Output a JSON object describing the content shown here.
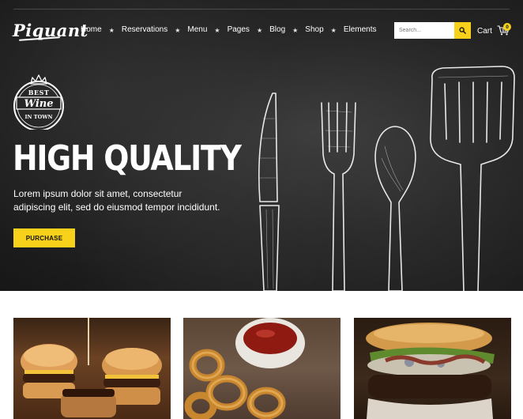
{
  "brand": {
    "name": "Piquant"
  },
  "nav": {
    "items": [
      {
        "label": "Home"
      },
      {
        "label": "Reservations"
      },
      {
        "label": "Menu"
      },
      {
        "label": "Pages"
      },
      {
        "label": "Blog"
      },
      {
        "label": "Shop"
      },
      {
        "label": "Elements"
      }
    ]
  },
  "search": {
    "placeholder": "Search..."
  },
  "cart": {
    "label": "Cart",
    "count": "0"
  },
  "hero": {
    "badge": {
      "top": "BEST",
      "middle": "Wine",
      "bottom": "IN TOWN"
    },
    "headline": "HIGH QUALITY",
    "subtext": "Lorem ipsum dolor sit amet, consectetur adipiscing elit, sed do eiusmod tempor incididunt.",
    "button_label": "PURCHASE"
  },
  "cards": [
    {
      "image": "sliders-burgers-photo"
    },
    {
      "image": "onion-rings-ketchup-photo"
    },
    {
      "image": "bacon-blue-cheese-burger-photo"
    }
  ],
  "colors": {
    "accent": "#f8d21a",
    "hero_bg": "#262626",
    "text_light": "#ffffff"
  }
}
